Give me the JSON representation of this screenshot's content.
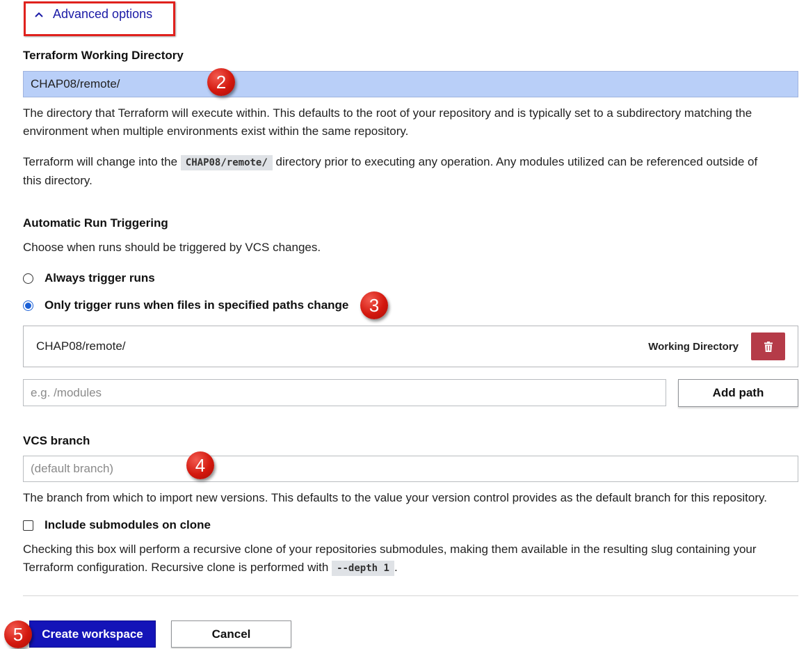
{
  "advanced": {
    "label": "Advanced options"
  },
  "working_directory": {
    "label": "Terraform Working Directory",
    "value": "CHAP08/remote/",
    "help1_line1": "The directory that Terraform will execute within. This defaults to the root of your repository and is typically set to a subdirectory matching the",
    "help1_line2": "environment when multiple environments exist within the same repository.",
    "help2_pre": "Terraform will change into the",
    "help2_code": "CHAP08/remote/",
    "help2_post": "directory prior to executing any operation. Any modules utilized can be referenced outside of",
    "help2_line2": "this directory."
  },
  "triggering": {
    "label": "Automatic Run Triggering",
    "help": "Choose when runs should be triggered by VCS changes.",
    "option_always": "Always trigger runs",
    "option_paths": "Only trigger runs when files in specified paths change",
    "selected": "option_paths",
    "paths": [
      {
        "path": "CHAP08/remote/",
        "tag": "Working Directory"
      }
    ],
    "path_input_placeholder": "e.g. /modules",
    "add_path_label": "Add path"
  },
  "vcs_branch": {
    "label": "VCS branch",
    "placeholder": "(default branch)",
    "help": "The branch from which to import new versions. This defaults to the value your version control provides as the default branch for this repository."
  },
  "submodules": {
    "label": "Include submodules on clone",
    "checked": false,
    "help_line1": "Checking this box will perform a recursive clone of your repositories submodules, making them available in the resulting slug containing your",
    "help_line2_pre": "Terraform configuration. Recursive clone is performed with",
    "help_code": "--depth 1",
    "help_line2_post": "."
  },
  "actions": {
    "create_label": "Create workspace",
    "cancel_label": "Cancel"
  },
  "annotations": {
    "b2": "2",
    "b3": "3",
    "b4": "4",
    "b5": "5"
  },
  "colors": {
    "primary": "#1414b8",
    "danger": "#b53b48",
    "annotation": "#d3180e",
    "input_filled": "#b9cff8",
    "link": "#1a1aa6"
  }
}
